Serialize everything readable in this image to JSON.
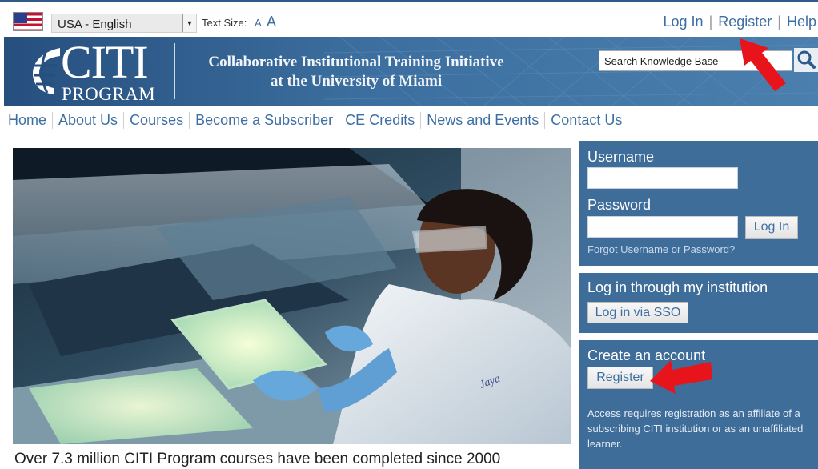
{
  "topbar": {
    "language": "USA - English",
    "text_size_label": "Text Size:",
    "text_size_small": "A",
    "text_size_large": "A",
    "links": {
      "login": "Log In",
      "register": "Register",
      "help": "Help"
    },
    "separator": "|"
  },
  "banner": {
    "logo_top": "CITI",
    "logo_bottom": "PROGRAM",
    "tagline_line1": "Collaborative Institutional Training Initiative",
    "tagline_line2": "at the University of Miami",
    "search_placeholder": "Search Knowledge Base"
  },
  "nav": {
    "items": [
      "Home",
      "About Us",
      "Courses",
      "Become a Subscriber",
      "CE Credits",
      "News and Events",
      "Contact Us"
    ]
  },
  "hero": {
    "caption": "Over 7.3 million CITI Program courses have been completed since 2000",
    "coat_name": "Jaya"
  },
  "login_panel": {
    "username_label": "Username",
    "password_label": "Password",
    "login_button": "Log In",
    "forgot_link": "Forgot Username or Password?"
  },
  "sso_panel": {
    "title": "Log in through my institution",
    "button": "Log in via SSO"
  },
  "create_panel": {
    "title": "Create an account",
    "button": "Register",
    "note": "Access requires registration as an affiliate of a subscribing CITI institution or as an unaffiliated learner."
  },
  "colors": {
    "link_blue": "#3d6fa3",
    "panel_blue": "#3f6d9a",
    "banner_blue": "#264f7e",
    "annotation_red": "#e8141c"
  }
}
